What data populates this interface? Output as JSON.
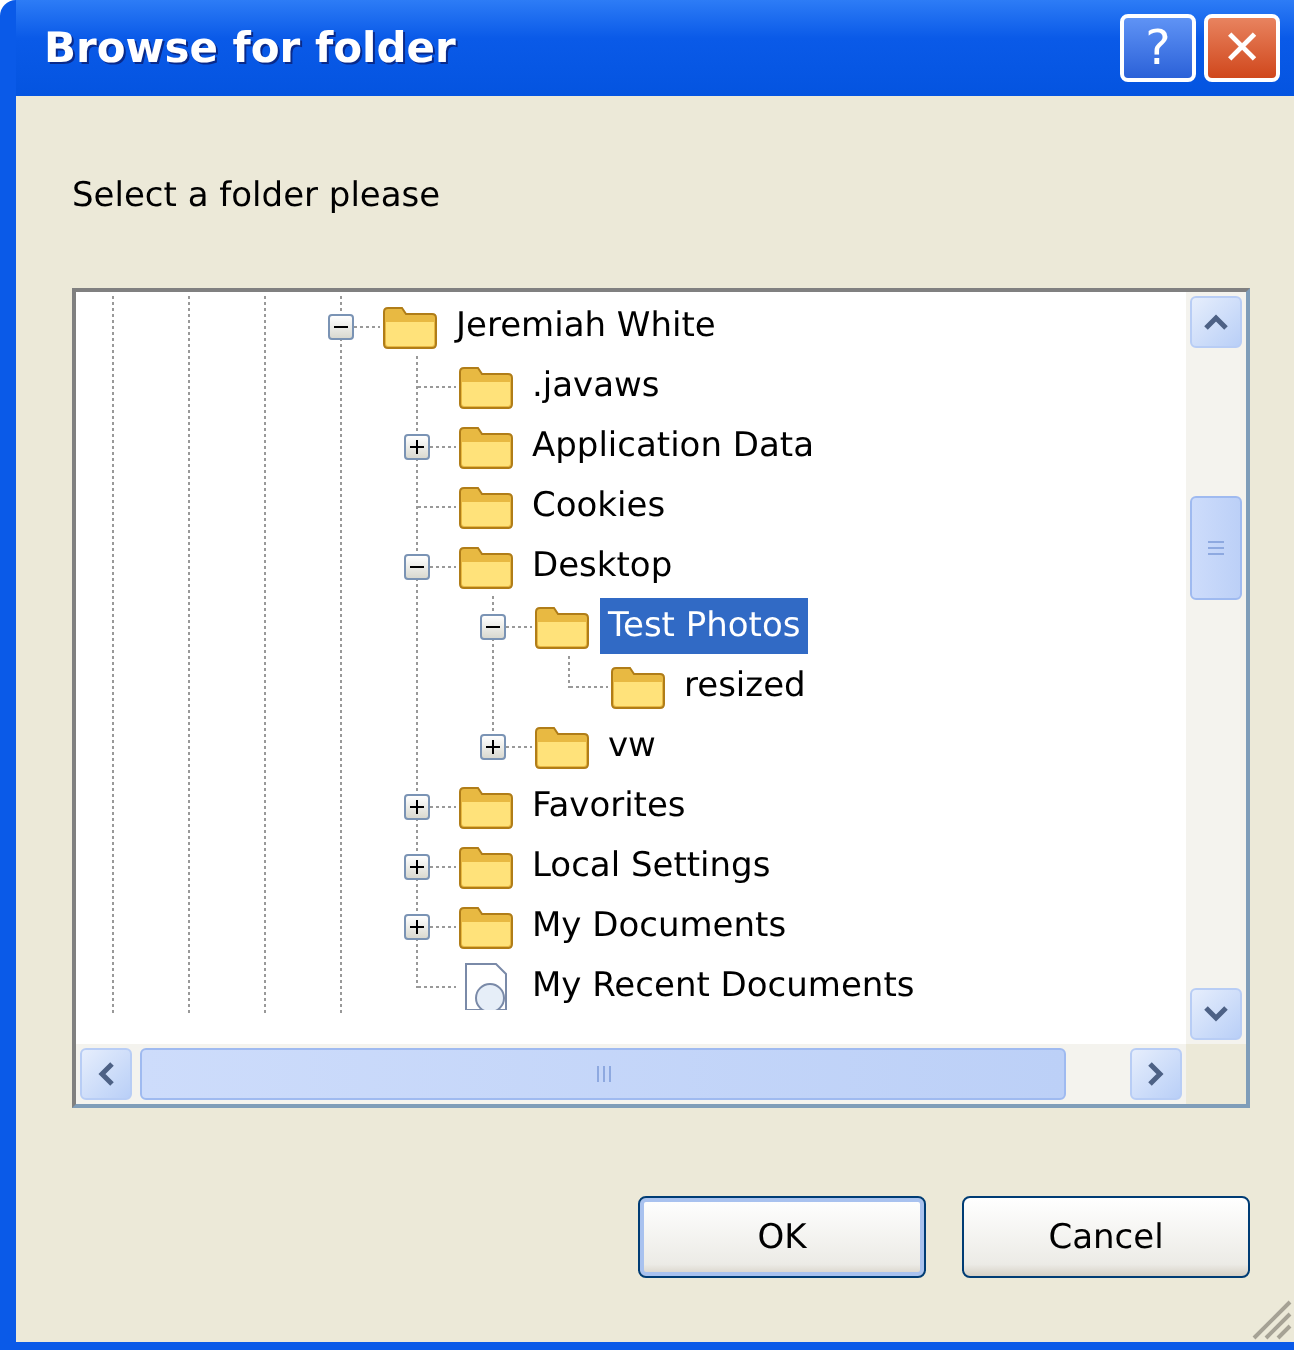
{
  "window": {
    "title": "Browse for folder",
    "title_buttons": [
      {
        "kind": "help",
        "label": "?"
      },
      {
        "kind": "close",
        "label": "✕"
      }
    ]
  },
  "prompt": "Select a folder please",
  "tree": [
    {
      "label": "Jeremiah White",
      "kind": "folder",
      "expanded": true,
      "selected": false,
      "children": [
        {
          "label": ".javaws",
          "kind": "folder",
          "selected": false
        },
        {
          "label": "Application Data",
          "kind": "folder",
          "expanded": false,
          "selected": false
        },
        {
          "label": "Cookies",
          "kind": "folder",
          "selected": false
        },
        {
          "label": "Desktop",
          "kind": "folder",
          "expanded": true,
          "selected": false,
          "children": [
            {
              "label": "Test Photos",
              "kind": "folder",
              "expanded": true,
              "selected": true,
              "children": [
                {
                  "label": "resized",
                  "kind": "folder",
                  "selected": false
                }
              ]
            },
            {
              "label": "vw",
              "kind": "folder",
              "expanded": false,
              "selected": false
            }
          ]
        },
        {
          "label": "Favorites",
          "kind": "folder",
          "expanded": false,
          "selected": false
        },
        {
          "label": "Local Settings",
          "kind": "folder",
          "expanded": false,
          "selected": false
        },
        {
          "label": "My Documents",
          "kind": "folder",
          "expanded": false,
          "selected": false
        },
        {
          "label": "My Recent Documents",
          "kind": "recent",
          "selected": false
        }
      ]
    }
  ],
  "buttons": [
    {
      "label": "OK",
      "default": true
    },
    {
      "label": "Cancel",
      "default": false
    }
  ]
}
